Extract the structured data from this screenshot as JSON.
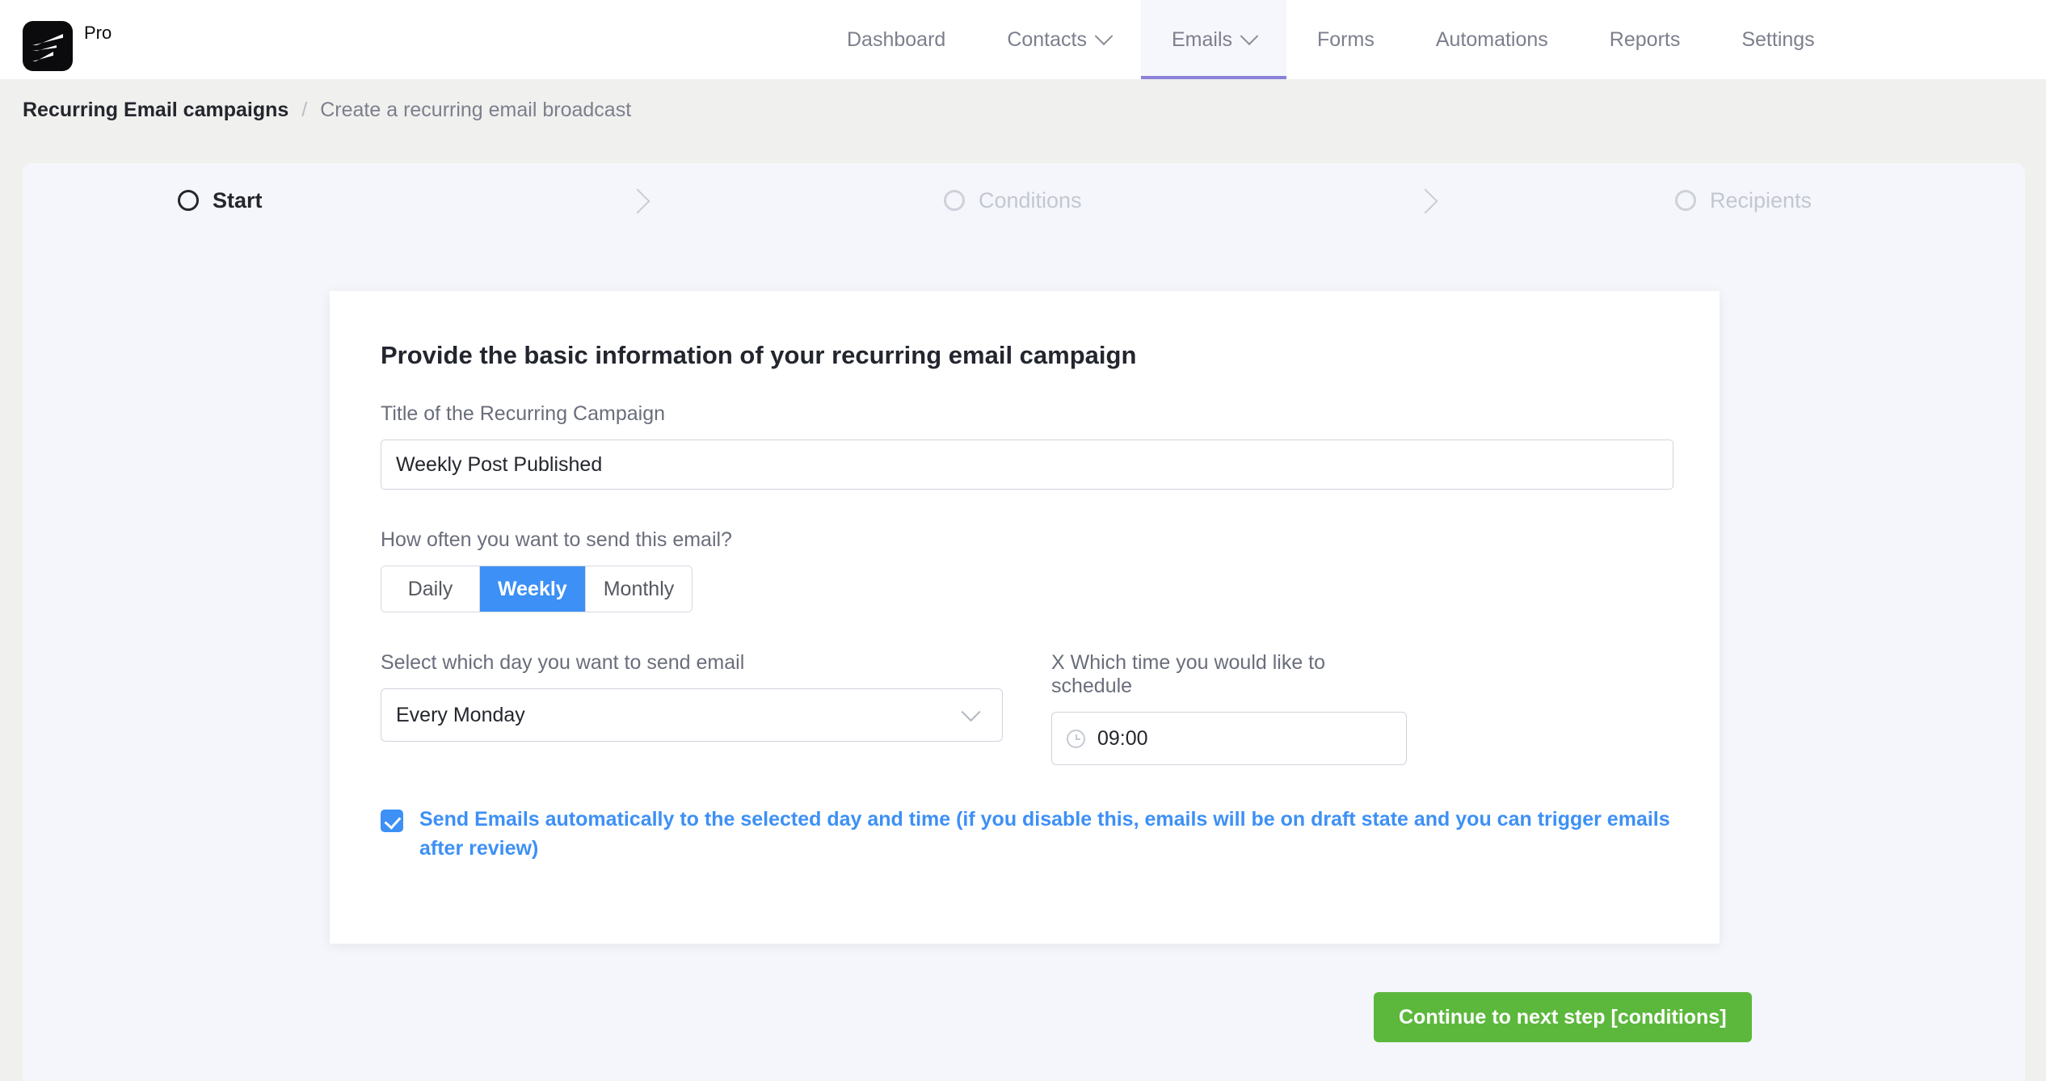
{
  "topbar": {
    "brand_name": "Pro",
    "logo_icon": "fluentcrm-logo-icon",
    "nav": [
      {
        "label": "Dashboard",
        "has_caret": false,
        "active": false
      },
      {
        "label": "Contacts",
        "has_caret": true,
        "active": false
      },
      {
        "label": "Emails",
        "has_caret": true,
        "active": true
      },
      {
        "label": "Forms",
        "has_caret": false,
        "active": false
      },
      {
        "label": "Automations",
        "has_caret": false,
        "active": false
      },
      {
        "label": "Reports",
        "has_caret": false,
        "active": false
      },
      {
        "label": "Settings",
        "has_caret": false,
        "active": false
      }
    ],
    "active_accent": "#8b82d9"
  },
  "breadcrumb": {
    "root": "Recurring Email campaigns",
    "separator": "/",
    "current": "Create a recurring email broadcast"
  },
  "stepper": {
    "steps": [
      {
        "label": "Start",
        "state": "active"
      },
      {
        "label": "Conditions",
        "state": "inactive"
      },
      {
        "label": "Recipients",
        "state": "inactive"
      }
    ],
    "arrow_icon": "chevron-right-icon"
  },
  "card": {
    "title": "Provide the basic information of your recurring email campaign",
    "title_field": {
      "label": "Title of the Recurring Campaign",
      "value": "Weekly Post Published",
      "placeholder": ""
    },
    "frequency": {
      "label": "How often you want to send this email?",
      "options": [
        "Daily",
        "Weekly",
        "Monthly"
      ],
      "selected": "Weekly",
      "selected_color": "#3d90f5"
    },
    "day": {
      "label": "Select which day you want to send email",
      "value": "Every Monday",
      "chevron_icon": "chevron-down-icon"
    },
    "time": {
      "label": "X Which time you would like to schedule",
      "value": "09:00",
      "icon": "clock-icon"
    },
    "auto_send": {
      "checked": true,
      "label": "Send Emails automatically to the selected day and time (if you disable this, emails will be on draft state and you can trigger emails after review)",
      "color": "#3d90f5"
    }
  },
  "footer": {
    "continue_label": "Continue to next step [conditions]",
    "continue_color": "#5cb83c"
  }
}
